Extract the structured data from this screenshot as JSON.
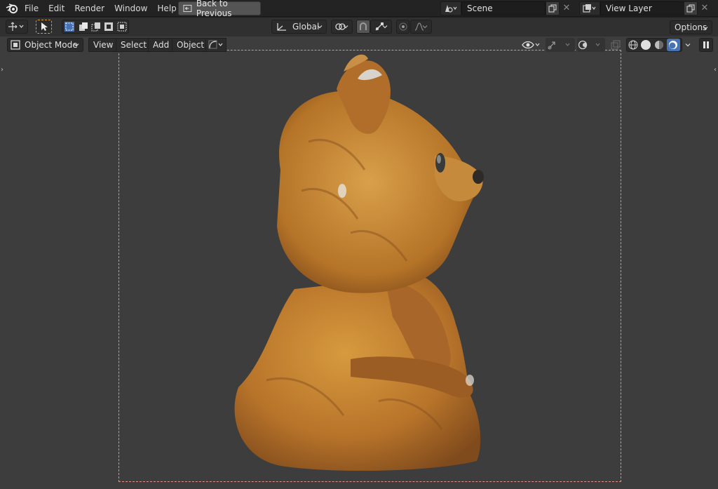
{
  "menu": [
    "File",
    "Edit",
    "Render",
    "Window",
    "Help"
  ],
  "back_button": "Back to Previous",
  "scene": {
    "name": "Scene"
  },
  "view_layer": {
    "name": "View Layer"
  },
  "toolbar": {
    "orientation": "Global",
    "options": "Options"
  },
  "viewport": {
    "mode": "Object Mode",
    "menus": [
      "View",
      "Select",
      "Add",
      "Object"
    ]
  },
  "colors": {
    "accent": "#4772b3",
    "viewport_bg": "#3d3d3d",
    "camera_frame": "#e08f8f",
    "active_tool": "#e0a030"
  },
  "icons": [
    "blender-logo",
    "back-icon",
    "scene-icon",
    "copy-icon",
    "close-icon",
    "view-layer-icon",
    "transform-icon",
    "select-tool-icon",
    "select-box-icon",
    "orientation-icon",
    "pivot-icon",
    "snap-icon",
    "proportional-icon",
    "object-mode-icon",
    "visibility-icon",
    "gizmo-icon",
    "overlay-icon",
    "xray-icon",
    "wireframe-icon",
    "solid-icon",
    "material-icon",
    "rendered-icon",
    "pause-icon"
  ]
}
